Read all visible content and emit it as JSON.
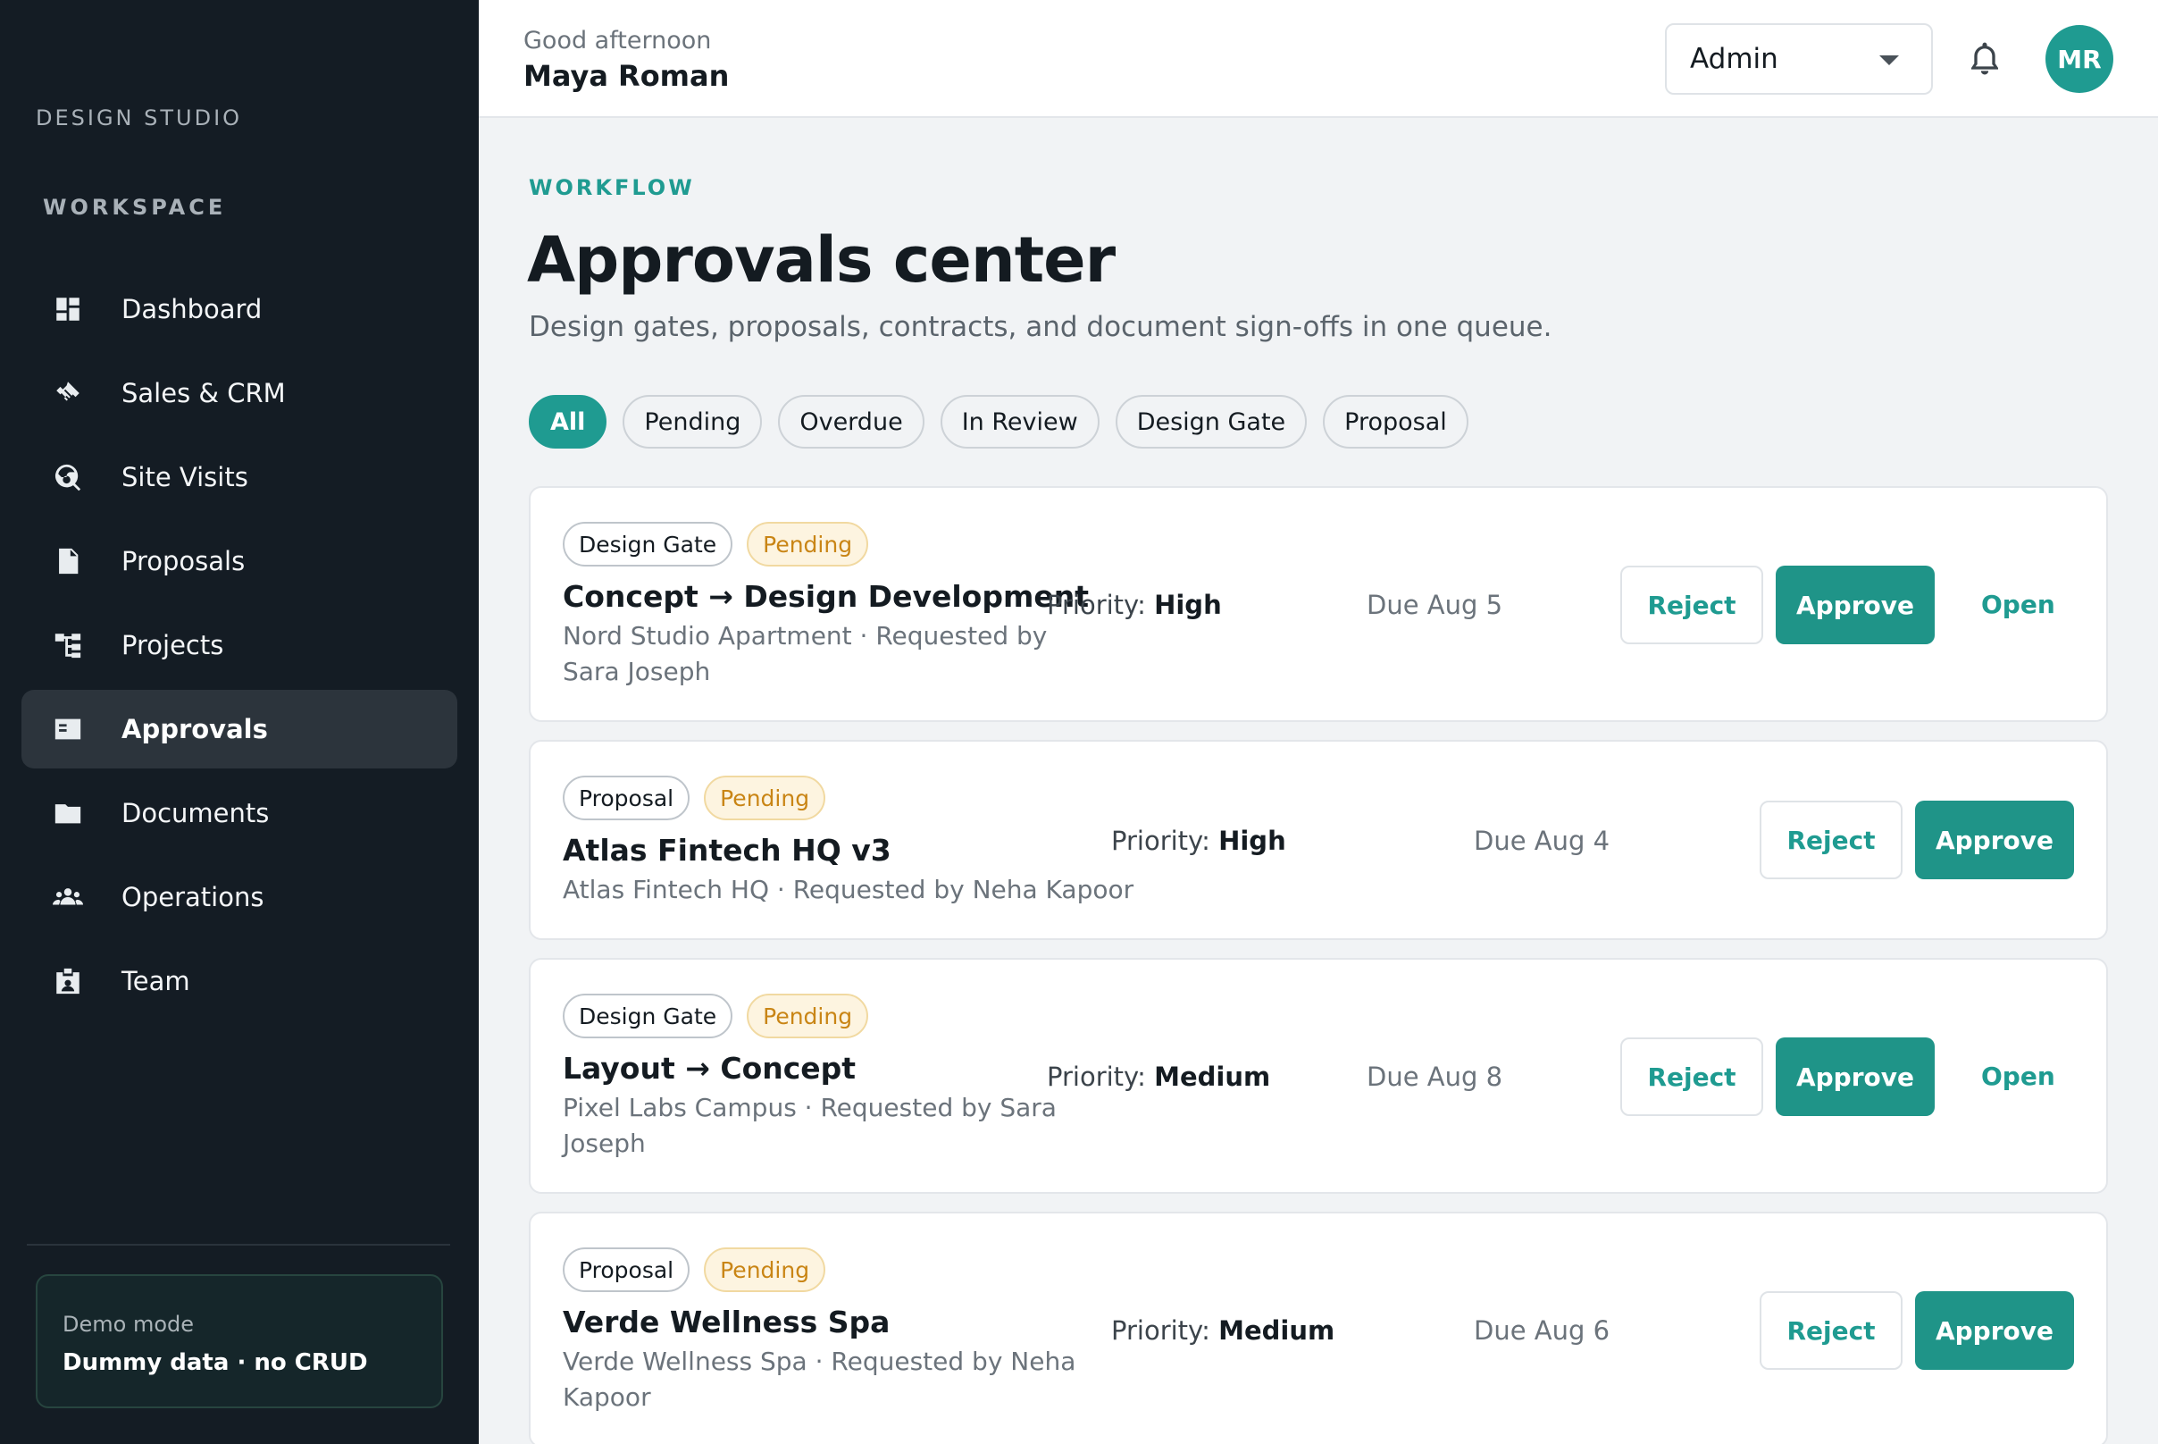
{
  "sidebar": {
    "brand": "DESIGN STUDIO",
    "section_label": "WORKSPACE",
    "items": [
      {
        "label": "Dashboard",
        "icon": "dashboard-icon"
      },
      {
        "label": "Sales & CRM",
        "icon": "handshake-icon"
      },
      {
        "label": "Site Visits",
        "icon": "globe-search-icon"
      },
      {
        "label": "Proposals",
        "icon": "document-icon"
      },
      {
        "label": "Projects",
        "icon": "workflow-icon"
      },
      {
        "label": "Approvals",
        "icon": "checklist-icon",
        "active": true
      },
      {
        "label": "Documents",
        "icon": "folder-icon"
      },
      {
        "label": "Operations",
        "icon": "people-icon"
      },
      {
        "label": "Team",
        "icon": "badge-icon"
      }
    ],
    "demo": {
      "title": "Demo mode",
      "subtitle": "Dummy data · no CRUD"
    }
  },
  "header": {
    "greeting": "Good afternoon",
    "user_name": "Maya Roman",
    "role": "Admin",
    "avatar_initials": "MR"
  },
  "main": {
    "eyebrow": "WORKFLOW",
    "title": "Approvals center",
    "subtitle": "Design gates, proposals, contracts, and document sign-offs in one queue.",
    "filters": [
      "All",
      "Pending",
      "Overdue",
      "In Review",
      "Design Gate",
      "Proposal"
    ],
    "approvals": [
      {
        "type": "Design Gate",
        "status": "Pending",
        "title": "Concept → Design Development",
        "meta_line1": "Nord Studio Apartment · Requested by",
        "meta_line2": "Sara Joseph",
        "priority_label": "Priority:",
        "priority": "High",
        "due": "Due Aug 5",
        "reject": "Reject",
        "approve": "Approve",
        "open": "Open"
      },
      {
        "type": "Proposal",
        "status": "Pending",
        "title": "Atlas Fintech HQ v3",
        "meta_line1": "Atlas Fintech HQ · Requested by Neha Kapoor",
        "priority_label": "Priority:",
        "priority": "High",
        "due": "Due Aug 4",
        "reject": "Reject",
        "approve": "Approve"
      },
      {
        "type": "Design Gate",
        "status": "Pending",
        "title": "Layout → Concept",
        "meta_line1": "Pixel Labs Campus · Requested by Sara",
        "meta_line2": "Joseph",
        "priority_label": "Priority:",
        "priority": "Medium",
        "due": "Due Aug 8",
        "reject": "Reject",
        "approve": "Approve",
        "open": "Open"
      },
      {
        "type": "Proposal",
        "status": "Pending",
        "title": "Verde Wellness Spa",
        "meta_line1": "Verde Wellness Spa · Requested by Neha",
        "meta_line2": "Kapoor",
        "priority_label": "Priority:",
        "priority": "Medium",
        "due": "Due Aug 6",
        "reject": "Reject",
        "approve": "Approve"
      }
    ]
  },
  "colors": {
    "accent": "#1f9b91",
    "sidebar_bg": "#141c24",
    "pending_text": "#c98515",
    "pending_bg": "#fdf4e0"
  }
}
